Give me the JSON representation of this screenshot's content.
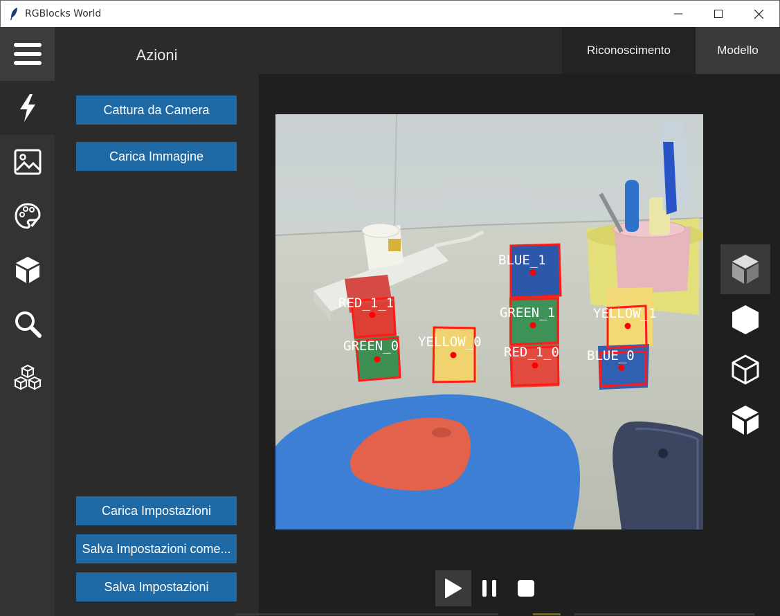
{
  "window": {
    "title": "RGBlocks World"
  },
  "rail": {
    "items": [
      "menu-icon",
      "lightning-icon",
      "image-icon",
      "palette-icon",
      "cube-icon",
      "search-icon",
      "blocks-icon"
    ]
  },
  "actions": {
    "title": "Azioni",
    "capture_label": "Cattura da Camera",
    "load_image_label": "Carica Immagine",
    "load_settings_label": "Carica Impostazioni",
    "save_settings_as_label": "Salva Impostazioni come...",
    "save_settings_label": "Salva Impostazioni"
  },
  "tabs": {
    "recognition": "Riconoscimento",
    "model": "Modello"
  },
  "detections": [
    {
      "label": "BLUE_1"
    },
    {
      "label": "RED_1_1"
    },
    {
      "label": "GREEN_1"
    },
    {
      "label": "YELLOW_1"
    },
    {
      "label": "GREEN_0"
    },
    {
      "label": "YELLOW_0"
    },
    {
      "label": "RED_1_0"
    },
    {
      "label": "BLUE_0"
    }
  ],
  "view_buttons": [
    "cube-solid-icon",
    "hexagon-icon",
    "cube-outline-icon",
    "cube-split-icon"
  ],
  "playback": [
    "play-icon",
    "pause-icon",
    "stop-icon"
  ],
  "colors": {
    "accent": "#1f6aa5",
    "detection_box": "#ff1a1a",
    "detection_center": "#ff0000"
  }
}
